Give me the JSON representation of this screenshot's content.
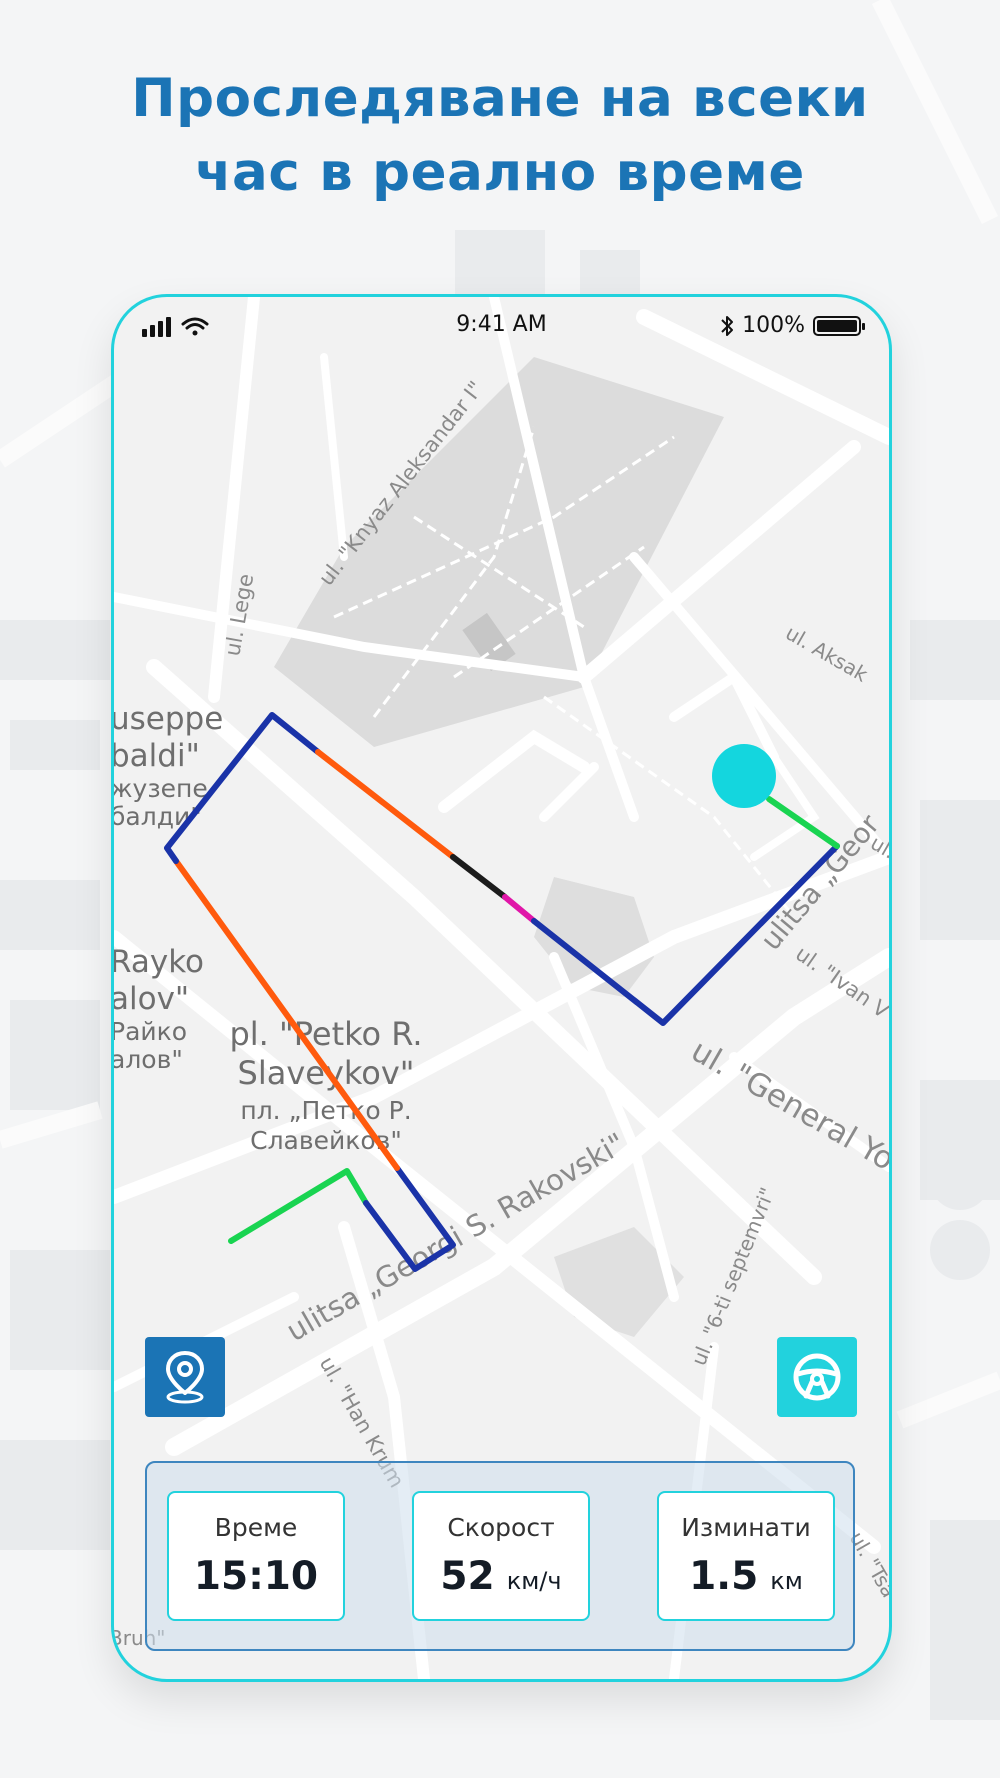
{
  "headline": {
    "line1": "Проследяване на всеки",
    "line2": "час в реално време"
  },
  "status_bar": {
    "time": "9:41 AM",
    "battery": "100%",
    "icons": [
      "signal-icon",
      "wifi-icon",
      "bluetooth-icon",
      "battery-icon"
    ]
  },
  "map": {
    "labels": {
      "knyaz": "ul. \"Knyaz Aleksandar I\"",
      "lege": "ul. Lege",
      "aksakov": "ul. Aksak",
      "giuseppe_1": "useppe",
      "giuseppe_2": "baldi\"",
      "giuseppe_bg_1": "жузепе",
      "giuseppe_bg_2": "балди\"",
      "rayko_1": "Rayko",
      "rayko_2": "alov\"",
      "rayko_bg_1": "Райко",
      "rayko_bg_2": "алов\"",
      "petko_1": "pl. \"Petko R.",
      "petko_2": "Slaveykov\"",
      "petko_bg_1": "пл. „Петко Р.",
      "petko_bg_2": "Славейков\"",
      "georgi_s": "ulitsa „Georgi S. Rakovski\"",
      "georgi_right": "ulitsa „Geor",
      "ivan": "ul. \"Ivan V",
      "general": "ul. \"General Yo",
      "sixth": "ul. \"6-ti septemvri\"",
      "han": "ul. \"Han Krum",
      "ul_right": "ul.",
      "tsa": "ul. \"Tsa",
      "bruh": "Bruh\""
    },
    "route_colors": [
      "#1a33a8",
      "#ff5a0d",
      "#19d451",
      "#1c1c1c",
      "#e016a8"
    ],
    "marker_color": "#14d6de"
  },
  "buttons": {
    "location_icon": "location-pin-icon",
    "drive_icon": "steering-wheel-icon"
  },
  "stats": {
    "time_label": "Време",
    "time_value": "15:10",
    "speed_label": "Скорост",
    "speed_value": "52",
    "speed_unit": "км/ч",
    "distance_label": "Изминати",
    "distance_value": "1.5",
    "distance_unit": "км"
  },
  "colors": {
    "accent_blue": "#1b74b5",
    "accent_cyan": "#22d2dd"
  }
}
